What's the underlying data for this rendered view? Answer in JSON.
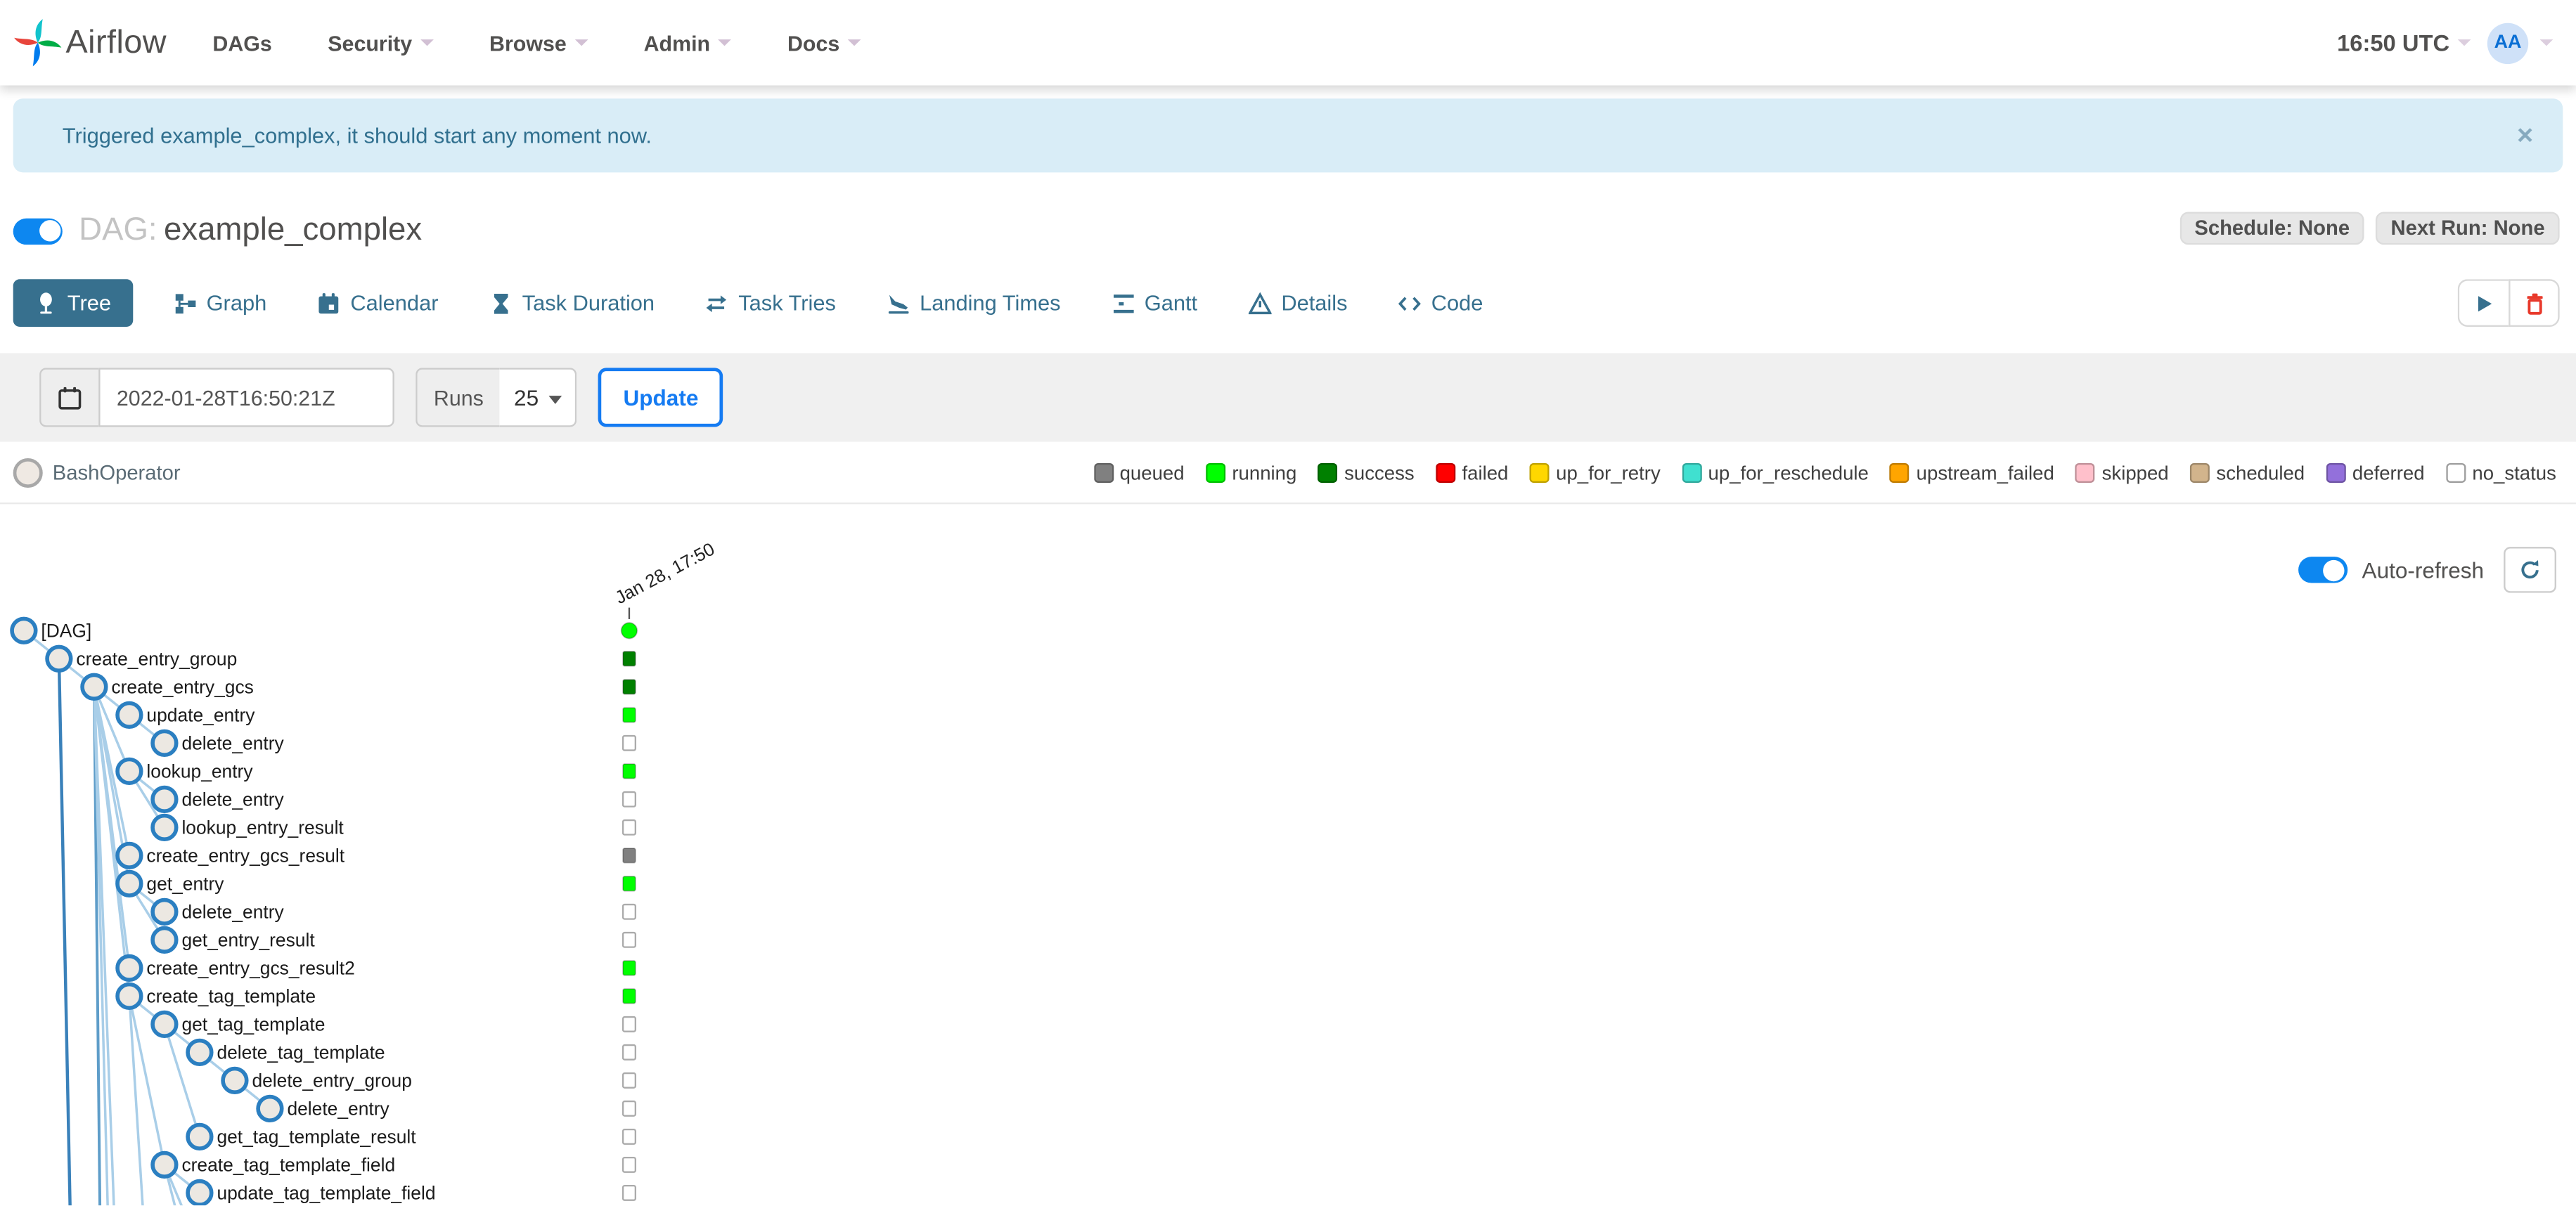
{
  "colors": {
    "accent_blue": "#0d87f0",
    "steel_blue": "#37708e",
    "node_stroke": "#2b7fc1",
    "node_fill": "#ece8e2",
    "edge_light": "#a9cee8",
    "edge_dark": "#3a81ba",
    "trash_red": "#e8392b"
  },
  "navbar": {
    "brand": "Airflow",
    "items": [
      {
        "label": "DAGs",
        "caret": false
      },
      {
        "label": "Security",
        "caret": true
      },
      {
        "label": "Browse",
        "caret": true
      },
      {
        "label": "Admin",
        "caret": true
      },
      {
        "label": "Docs",
        "caret": true
      }
    ],
    "clock": "16:50 UTC",
    "avatar_initials": "AA"
  },
  "alert": {
    "message": "Triggered example_complex, it should start any moment now.",
    "close_label": "×"
  },
  "dag_header": {
    "prefix": "DAG:",
    "name": "example_complex",
    "badges": [
      "Schedule: None",
      "Next Run: None"
    ]
  },
  "tabs": [
    {
      "label": "Tree",
      "icon": "tree-icon",
      "active": true
    },
    {
      "label": "Graph",
      "icon": "graph-icon",
      "active": false
    },
    {
      "label": "Calendar",
      "icon": "calendar-icon",
      "active": false
    },
    {
      "label": "Task Duration",
      "icon": "hourglass-icon",
      "active": false
    },
    {
      "label": "Task Tries",
      "icon": "retry-icon",
      "active": false
    },
    {
      "label": "Landing Times",
      "icon": "landing-icon",
      "active": false
    },
    {
      "label": "Gantt",
      "icon": "gantt-icon",
      "active": false
    },
    {
      "label": "Details",
      "icon": "details-icon",
      "active": false
    },
    {
      "label": "Code",
      "icon": "code-icon",
      "active": false
    }
  ],
  "dag_actions": [
    {
      "name": "trigger-dag-button",
      "icon": "play-icon"
    },
    {
      "name": "delete-dag-button",
      "icon": "trash-icon"
    }
  ],
  "filter_bar": {
    "date_value": "2022-01-28T16:50:21Z",
    "runs_label": "Runs",
    "runs_value": "25",
    "update_label": "Update"
  },
  "legend": {
    "operators": [
      {
        "name": "BashOperator"
      }
    ],
    "statuses": [
      {
        "label": "queued",
        "color": "#808080"
      },
      {
        "label": "running",
        "color": "#00ff00"
      },
      {
        "label": "success",
        "color": "#008000"
      },
      {
        "label": "failed",
        "color": "#ff0000"
      },
      {
        "label": "up_for_retry",
        "color": "#ffd700"
      },
      {
        "label": "up_for_reschedule",
        "color": "#40e0d0"
      },
      {
        "label": "upstream_failed",
        "color": "#ffa500"
      },
      {
        "label": "skipped",
        "color": "#ffc0cb"
      },
      {
        "label": "scheduled",
        "color": "#d2b48c"
      },
      {
        "label": "deferred",
        "color": "#9370db"
      },
      {
        "label": "no_status",
        "color": "#ffffff"
      }
    ]
  },
  "auto_refresh": {
    "label": "Auto-refresh",
    "enabled": true
  },
  "chart_data": {
    "type": "tree",
    "run_column_label": "Jan 28, 17:50",
    "status_colors": {
      "running": "#00ff00",
      "success": "#008000",
      "queued": "#808080",
      "no_status": "#ffffff"
    },
    "tasks": [
      {
        "name": "[DAG]",
        "level": 0,
        "parent": null,
        "status": "running"
      },
      {
        "name": "create_entry_group",
        "level": 1,
        "parent": 0,
        "status": "success"
      },
      {
        "name": "create_entry_gcs",
        "level": 2,
        "parent": 1,
        "status": "success"
      },
      {
        "name": "update_entry",
        "level": 3,
        "parent": 2,
        "status": "running"
      },
      {
        "name": "delete_entry",
        "level": 4,
        "parent": 3,
        "status": "no_status"
      },
      {
        "name": "lookup_entry",
        "level": 3,
        "parent": 2,
        "status": "running"
      },
      {
        "name": "delete_entry",
        "level": 4,
        "parent": 5,
        "status": "no_status"
      },
      {
        "name": "lookup_entry_result",
        "level": 4,
        "parent": 5,
        "status": "no_status"
      },
      {
        "name": "create_entry_gcs_result",
        "level": 3,
        "parent": 2,
        "status": "queued"
      },
      {
        "name": "get_entry",
        "level": 3,
        "parent": 2,
        "status": "running"
      },
      {
        "name": "delete_entry",
        "level": 4,
        "parent": 9,
        "status": "no_status"
      },
      {
        "name": "get_entry_result",
        "level": 4,
        "parent": 9,
        "status": "no_status"
      },
      {
        "name": "create_entry_gcs_result2",
        "level": 3,
        "parent": 2,
        "status": "running"
      },
      {
        "name": "create_tag_template",
        "level": 3,
        "parent": 2,
        "status": "running"
      },
      {
        "name": "get_tag_template",
        "level": 4,
        "parent": 13,
        "status": "no_status"
      },
      {
        "name": "delete_tag_template",
        "level": 5,
        "parent": 14,
        "status": "no_status"
      },
      {
        "name": "delete_entry_group",
        "level": 6,
        "parent": 15,
        "status": "no_status"
      },
      {
        "name": "delete_entry",
        "level": 7,
        "parent": 16,
        "status": "no_status"
      },
      {
        "name": "get_tag_template_result",
        "level": 5,
        "parent": 14,
        "status": "no_status"
      },
      {
        "name": "create_tag_template_field",
        "level": 4,
        "parent": 13,
        "status": "no_status"
      },
      {
        "name": "update_tag_template_field",
        "level": 5,
        "parent": 19,
        "status": "no_status"
      }
    ]
  }
}
